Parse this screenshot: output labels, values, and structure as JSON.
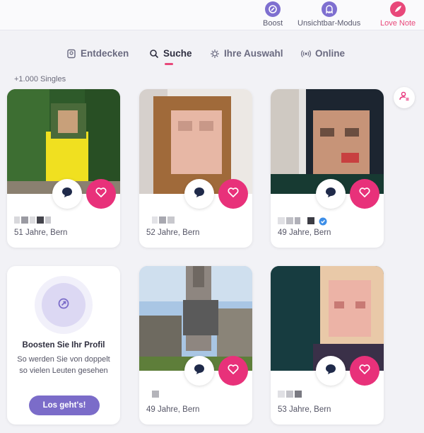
{
  "topbar": {
    "boost_label": "Boost",
    "invisible_label": "Unsichtbar-Modus",
    "love_note_label": "Love Note"
  },
  "tabs": [
    {
      "label": "Entdecken",
      "icon": "discover-icon",
      "active": false
    },
    {
      "label": "Suche",
      "icon": "search-icon",
      "active": true
    },
    {
      "label": "Ihre Auswahl",
      "icon": "selection-icon",
      "active": false
    },
    {
      "label": "Online",
      "icon": "online-icon",
      "active": false
    }
  ],
  "results_count": "+1.000 Singles",
  "profiles": [
    {
      "info": "51 Jahre, Bern",
      "verified": false
    },
    {
      "info": "52 Jahre, Bern",
      "verified": false
    },
    {
      "info": "49 Jahre, Bern",
      "verified": true
    },
    {
      "info": "49 Jahre, Bern",
      "verified": false
    },
    {
      "info": "53 Jahre, Bern",
      "verified": false
    }
  ],
  "boost_card": {
    "title": "Boosten Sie Ihr Profil",
    "text": "So werden Sie von doppelt so vielen Leuten gesehen",
    "button_label": "Los geht's!"
  },
  "colors": {
    "accent_pink": "#e8317a",
    "accent_purple": "#7b6cc9",
    "background": "#f2f2f6"
  }
}
